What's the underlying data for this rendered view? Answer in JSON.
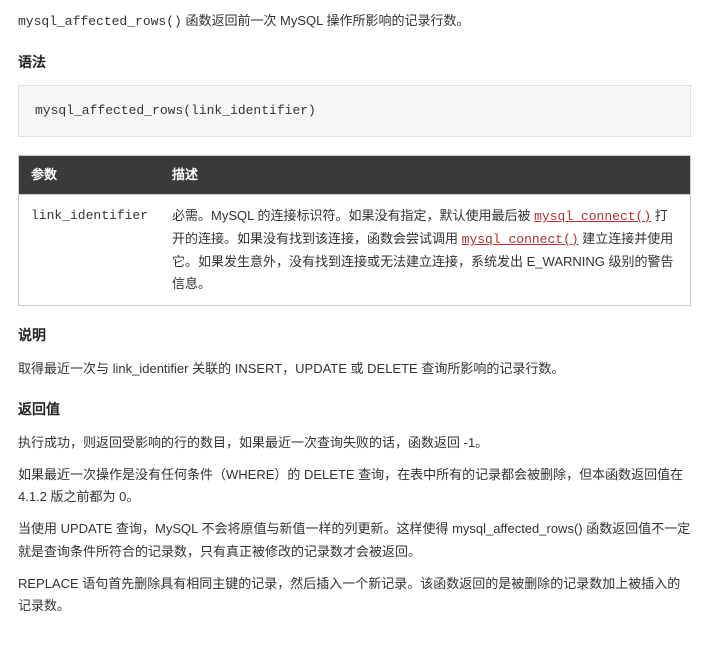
{
  "intro": {
    "fn": "mysql_affected_rows()",
    "tail": " 函数返回前一次 MySQL 操作所影响的记录行数。"
  },
  "syntax": {
    "heading": "语法",
    "code": "mysql_affected_rows(link_identifier)"
  },
  "table": {
    "h1": "参数",
    "h2": "描述",
    "param": "link_identifier",
    "d1": "必需。MySQL 的连接标识符。如果没有指定，默认使用最后被 ",
    "link1": "mysql_connect()",
    "d2": " 打开的连接。如果没有找到该连接，函数会尝试调用 ",
    "link2": "mysql_connect()",
    "d3": " 建立连接并使用它。如果发生意外，没有找到连接或无法建立连接，系统发出 E_WARNING 级别的警告信息。"
  },
  "explain": {
    "heading": "说明",
    "text": "取得最近一次与 link_identifier 关联的 INSERT，UPDATE 或 DELETE 查询所影响的记录行数。"
  },
  "return": {
    "heading": "返回值",
    "p1": "执行成功，则返回受影响的行的数目，如果最近一次查询失败的话，函数返回 -1。",
    "p2": "如果最近一次操作是没有任何条件（WHERE）的 DELETE 查询，在表中所有的记录都会被删除，但本函数返回值在 4.1.2 版之前都为 0。",
    "p3": "当使用 UPDATE 查询，MySQL 不会将原值与新值一样的列更新。这样使得 mysql_affected_rows() 函数返回值不一定就是查询条件所符合的记录数，只有真正被修改的记录数才会被返回。",
    "p4": "REPLACE 语句首先删除具有相同主键的记录，然后插入一个新记录。该函数返回的是被删除的记录数加上被插入的记录数。"
  }
}
